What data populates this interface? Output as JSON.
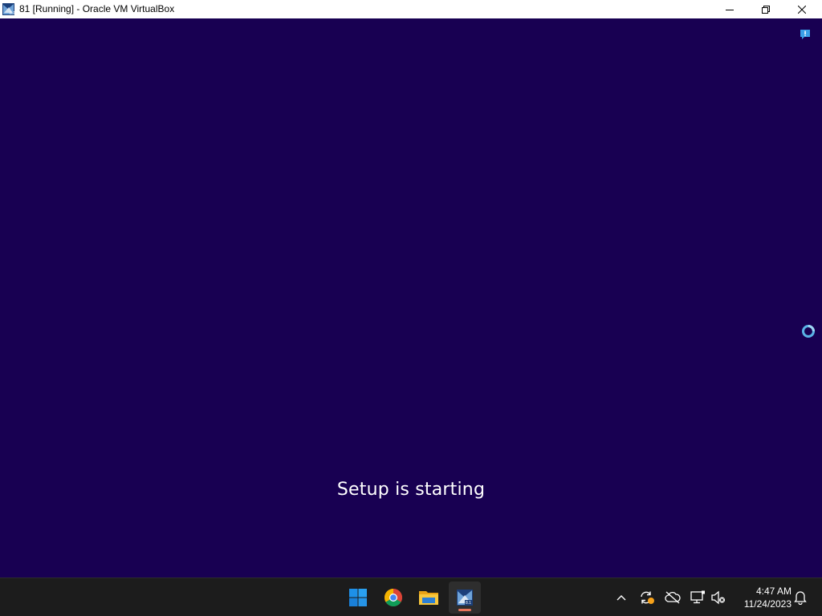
{
  "window": {
    "title": "81 [Running] - Oracle VM VirtualBox",
    "controls": {
      "minimize": "minimize",
      "maximize": "restore",
      "close": "close"
    }
  },
  "vm": {
    "background_color": "#180052",
    "status_text": "Setup is starting",
    "icons": [
      "notification-badge-icon",
      "busy-spinner-icon"
    ]
  },
  "taskbar": {
    "apps": [
      {
        "name": "Start",
        "icon": "windows-logo-icon"
      },
      {
        "name": "Google Chrome",
        "icon": "chrome-icon"
      },
      {
        "name": "File Explorer",
        "icon": "folder-icon"
      },
      {
        "name": "Oracle VM VirtualBox",
        "icon": "virtualbox-icon",
        "active": true
      }
    ],
    "tray": [
      "chevron-up-icon",
      "sync-warning-icon",
      "cloud-offline-icon",
      "network-icon",
      "volume-muted-icon"
    ],
    "clock": {
      "time": "4:47 AM",
      "date": "11/24/2023"
    },
    "notification_icon": "bell-icon"
  },
  "colors": {
    "vm_background": "#180052",
    "taskbar": "#1c1c1c",
    "active_indicator": "#e8755c",
    "accent_blue": "#0078d4"
  }
}
